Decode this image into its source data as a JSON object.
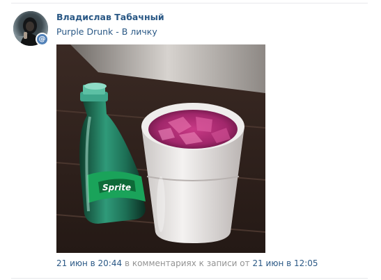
{
  "post": {
    "author_name": "Владислав Табачный",
    "text": "Purple Drunk - В личку",
    "avatar_badge": "@",
    "photo_subject": "sprite-bottle-and-foam-cup",
    "meta": {
      "time": "21 июн в 20:44",
      "context": " в комментариях к записи от ",
      "parent_time": "21 июн в 12:05"
    }
  },
  "colors": {
    "link": "#2a5885",
    "muted": "#939393",
    "accent": "#5181b8",
    "divider": "#e7e8ec"
  },
  "icons": {
    "mention_badge": "at-sign-icon"
  }
}
